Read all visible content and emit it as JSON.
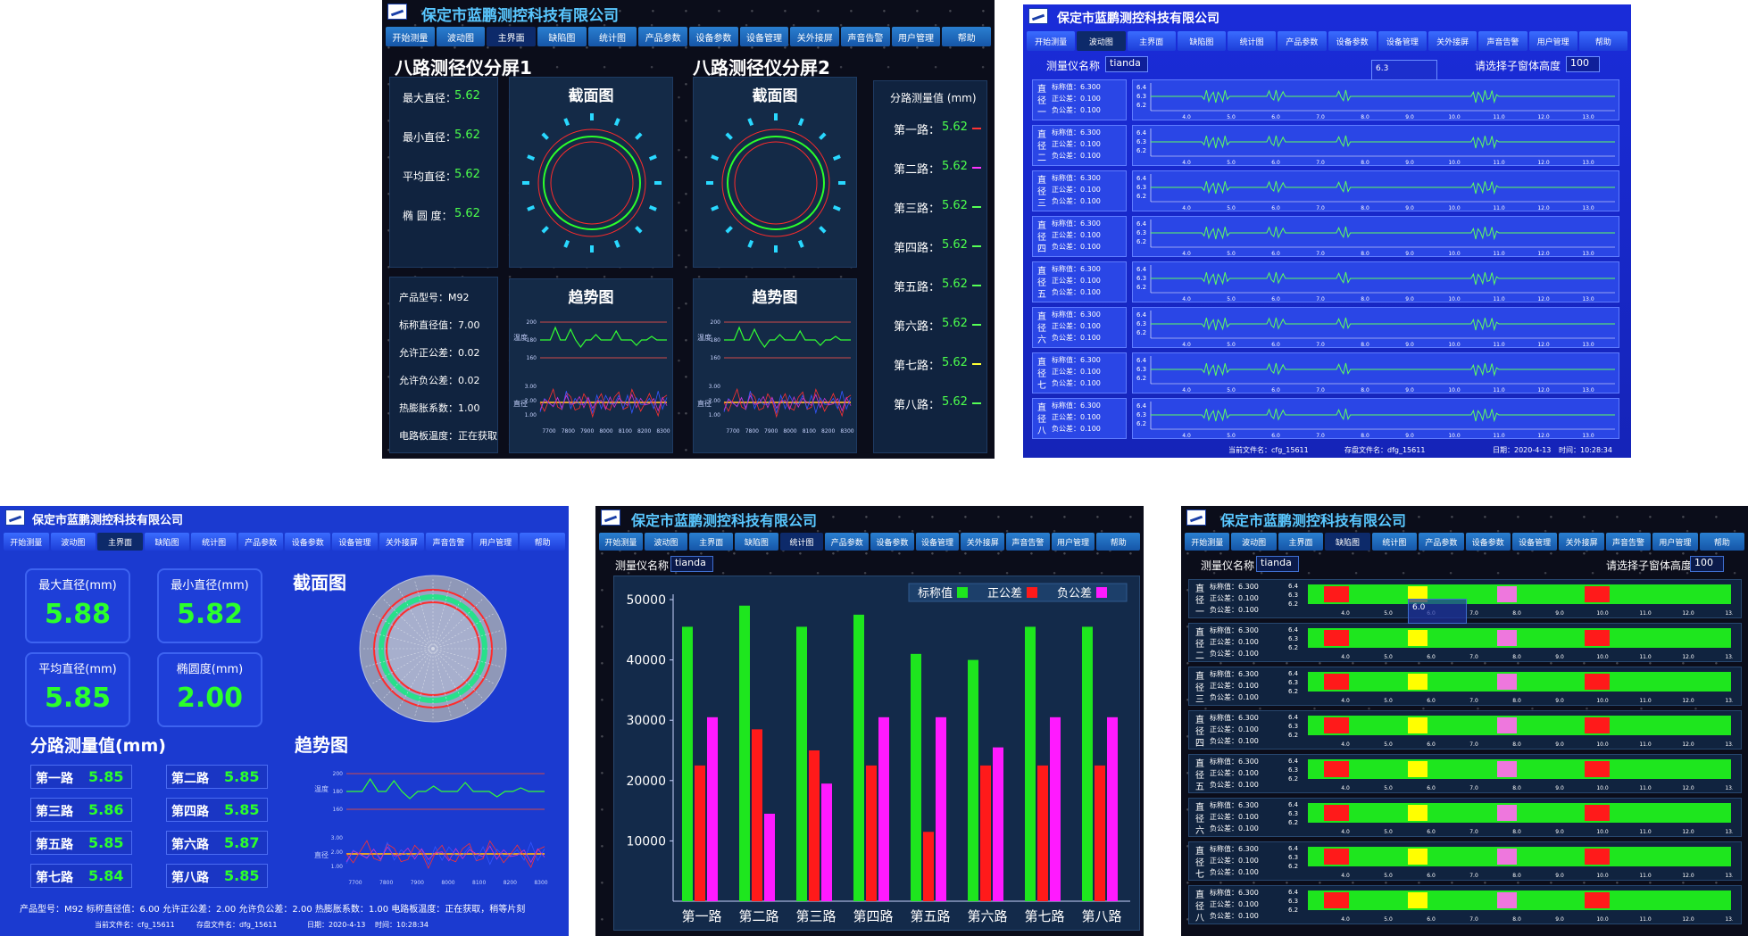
{
  "company": "保定市蓝鹏测控科技有限公司",
  "nav": [
    "开始测量",
    "波动图",
    "主界面",
    "缺陷图",
    "统计图",
    "产品参数",
    "设备参数",
    "设备管理",
    "关外接屏",
    "声音告警",
    "用户管理",
    "帮助"
  ],
  "screen1": {
    "title_left": "八路测径仪分屏1",
    "title_right": "八路测径仪分屏2",
    "section_title": "截面图",
    "trend_title": "趋势图",
    "stats": [
      {
        "label": "最大直径：",
        "value": "5.62"
      },
      {
        "label": "最小直径：",
        "value": "5.62"
      },
      {
        "label": "平均直径：",
        "value": "5.62"
      },
      {
        "label": "椭 圆 度：",
        "value": "5.62"
      }
    ],
    "params": [
      "产品型号：M92",
      "标称直径值：7.00",
      "允许正公差：0.02",
      "允许负公差：0.02",
      "热膨胀系数：1.00",
      "电路板温度：正在获取"
    ],
    "channels_title": "分路测量值 (mm)",
    "channels": [
      {
        "label": "第一路：",
        "value": "5.62"
      },
      {
        "label": "第二路：",
        "value": "5.62"
      },
      {
        "label": "第三路：",
        "value": "5.62"
      },
      {
        "label": "第四路：",
        "value": "5.62"
      },
      {
        "label": "第五路：",
        "value": "5.62"
      },
      {
        "label": "第六路：",
        "value": "5.62"
      },
      {
        "label": "第七路：",
        "value": "5.62"
      },
      {
        "label": "第八路：",
        "value": "5.62"
      }
    ],
    "trend_temp_label": "温度",
    "trend_dia_label": "直径",
    "trend_y_temp": [
      "200",
      "180",
      "160"
    ],
    "trend_y_dia": [
      "3.00",
      "2.00",
      "1.00"
    ],
    "trend_x": [
      "7700",
      "7800",
      "7900",
      "8000",
      "8100",
      "8200",
      "8300"
    ]
  },
  "screen2": {
    "instrument_label": "测量仪名称",
    "instrument_value": "tianda",
    "height_label": "请选择子窗体高度",
    "height_value": "100",
    "tooltip": "6.3",
    "rows": [
      "一",
      "二",
      "三",
      "四",
      "五",
      "六",
      "七",
      "八"
    ],
    "row_prefix": [
      "直",
      "径"
    ],
    "row_params": [
      "标称值：6.300",
      "正公差：0.100",
      "负公差：0.100"
    ],
    "y_ticks": [
      "6.4",
      "6.3",
      "6.2"
    ],
    "x_ticks": [
      "4.0",
      "5.0",
      "6.0",
      "7.0",
      "8.0",
      "9.0",
      "10.0",
      "11.0",
      "12.0",
      "13.0"
    ],
    "footer": [
      "当前文件名：cfg_15611",
      "存盘文件名：dfg_15611",
      "日期：2020-4-13",
      "时间：10:28:34"
    ]
  },
  "screen3": {
    "cards": [
      {
        "label": "最大直径(mm)",
        "value": "5.88"
      },
      {
        "label": "最小直径(mm)",
        "value": "5.82"
      },
      {
        "label": "平均直径(mm)",
        "value": "5.85"
      },
      {
        "label": "椭圆度(mm)",
        "value": "2.00"
      }
    ],
    "section_title": "截面图",
    "trend_title": "趋势图",
    "channels_title": "分路测量值(mm)",
    "channels": [
      {
        "label": "第一路",
        "value": "5.85"
      },
      {
        "label": "第二路",
        "value": "5.85"
      },
      {
        "label": "第三路",
        "value": "5.86"
      },
      {
        "label": "第四路",
        "value": "5.85"
      },
      {
        "label": "第五路",
        "value": "5.85"
      },
      {
        "label": "第六路",
        "value": "5.87"
      },
      {
        "label": "第七路",
        "value": "5.84"
      },
      {
        "label": "第八路",
        "value": "5.85"
      }
    ],
    "footer_params": "产品型号：M92  标称直径值：6.00  允许正公差：2.00  允许负公差：2.00  热膨胀系数：1.00     电路板温度：正在获取，稍等片刻",
    "footer_files": [
      "当前文件名：cfg_15611",
      "存盘文件名：dfg_15611",
      "日期：2020-4-13",
      "时间：10:28:34"
    ]
  },
  "screen4": {
    "instrument_label": "测量仪名称",
    "instrument_value": "tianda",
    "legend": [
      "标称值",
      "正公差",
      "负公差"
    ],
    "colors": {
      "nominal": "#1ee61e",
      "plus": "#ff1a1a",
      "minus": "#ff1aff"
    }
  },
  "chart_data": {
    "type": "bar",
    "categories": [
      "第一路",
      "第二路",
      "第三路",
      "第四路",
      "第五路",
      "第六路",
      "第七路",
      "第八路"
    ],
    "series": [
      {
        "name": "标称值",
        "values": [
          45500,
          49000,
          45500,
          47500,
          41000,
          40000,
          45500,
          45500
        ]
      },
      {
        "name": "正公差",
        "values": [
          22500,
          28500,
          25000,
          22500,
          11500,
          22500,
          22500,
          22500
        ]
      },
      {
        "name": "负公差",
        "values": [
          30500,
          14500,
          19500,
          30500,
          30500,
          25500,
          30500,
          30500
        ]
      }
    ],
    "y_ticks": [
      "10000",
      "20000",
      "30000",
      "40000",
      "50000"
    ],
    "ylim": [
      0,
      50000
    ],
    "legend_position": "top-right"
  },
  "screen5": {
    "instrument_label": "测量仪名称",
    "instrument_value": "tianda",
    "height_label": "请选择子窗体高度",
    "height_value": "100",
    "tooltip": "6.0",
    "rows": [
      "一",
      "二",
      "三",
      "四",
      "五",
      "六",
      "七",
      "八"
    ],
    "row_prefix": [
      "直",
      "径"
    ],
    "row_params": [
      "标称值：6.300",
      "正公差：0.100",
      "负公差：0.100"
    ],
    "y_ticks": [
      "6.4",
      "6.3",
      "6.2"
    ],
    "x_ticks": [
      "4.0",
      "5.0",
      "6.0",
      "7.0",
      "8.0",
      "9.0",
      "10.0",
      "11.0",
      "12.0",
      "13.0"
    ]
  }
}
